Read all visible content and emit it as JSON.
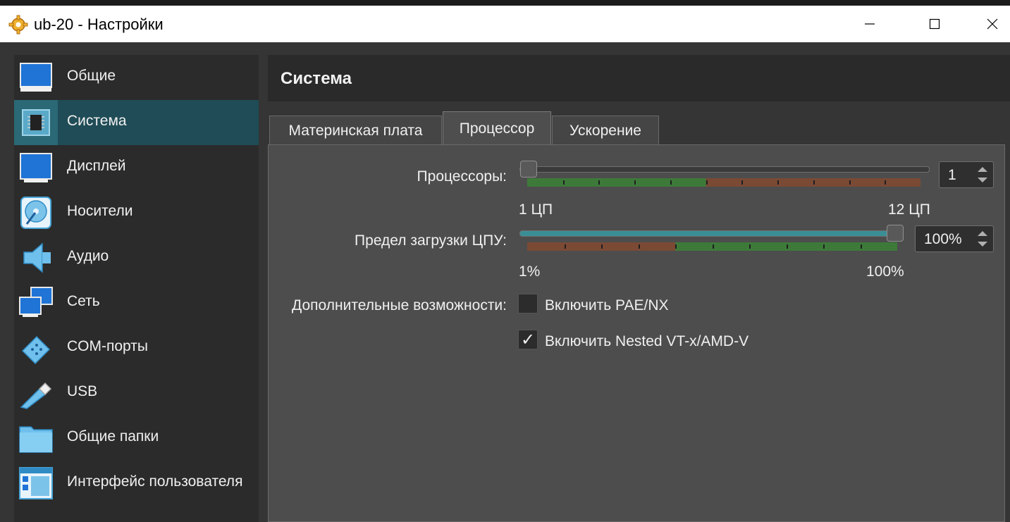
{
  "window": {
    "title": "ub-20 - Настройки",
    "controls": [
      "minimize-icon",
      "maximize-icon",
      "close-icon"
    ]
  },
  "sidebar": {
    "items": [
      {
        "label": "Общие",
        "icon": "monitor-icon",
        "active": false
      },
      {
        "label": "Система",
        "icon": "chip-icon",
        "active": true
      },
      {
        "label": "Дисплей",
        "icon": "display-icon",
        "active": false
      },
      {
        "label": "Носители",
        "icon": "disk-icon",
        "active": false
      },
      {
        "label": "Аудио",
        "icon": "speaker-icon",
        "active": false
      },
      {
        "label": "Сеть",
        "icon": "network-icon",
        "active": false
      },
      {
        "label": "COM-порты",
        "icon": "serial-port-icon",
        "active": false
      },
      {
        "label": "USB",
        "icon": "usb-icon",
        "active": false
      },
      {
        "label": "Общие папки",
        "icon": "folder-icon",
        "active": false
      },
      {
        "label": "Интерфейс пользователя",
        "icon": "ui-window-icon",
        "active": false
      }
    ]
  },
  "header": {
    "title": "Система"
  },
  "tabs": [
    {
      "label": "Материнская плата",
      "active": false
    },
    {
      "label": "Процессор",
      "active": true
    },
    {
      "label": "Ускорение",
      "active": false
    }
  ],
  "processor": {
    "cpu_label": "Процессоры:",
    "cpu_value": 1,
    "cpu_spin_text": "1",
    "cpu_min_label": "1 ЦП",
    "cpu_max_label": "12 ЦП",
    "cpu_min": 1,
    "cpu_max": 12,
    "cpu_recommended_max": 6,
    "cap_label": "Предел загрузки ЦПУ:",
    "cap_value": 100,
    "cap_spin_text": "100%",
    "cap_min_label": "1%",
    "cap_max_label": "100%",
    "cap_warn_below": 40,
    "features_label": "Дополнительные возможности:",
    "pae": {
      "label": "Включить PAE/NX",
      "checked": false
    },
    "nested": {
      "label": "Включить Nested VT-x/AMD-V",
      "checked": true
    }
  },
  "colors": {
    "ok": "#3d7a3a",
    "warn": "#7a4a35",
    "active_item": "#1f4c56",
    "slider_fill": "#3a8e96"
  }
}
